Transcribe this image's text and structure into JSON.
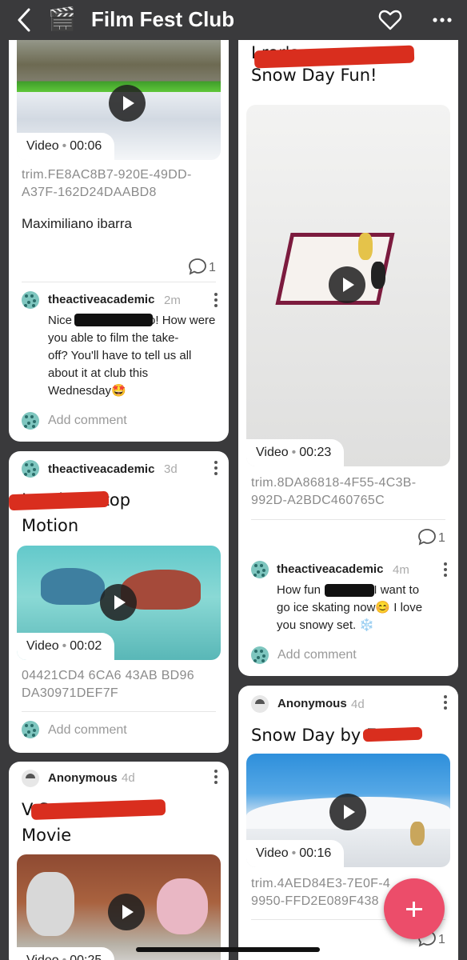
{
  "header": {
    "title": "Film Fest Club",
    "app_icon": "🎬"
  },
  "cards": {
    "c1": {
      "video_label": "Video",
      "duration": "00:06",
      "filename_line1": "trim.FE8AC8B7-920E-49DD-",
      "filename_line2": "A37F-162D24DAABD8",
      "author_text": "Maximiliano ibarra",
      "comment_count": "1",
      "comment": {
        "user": "theactiveacademic",
        "time": "2m",
        "l1a": "Nice",
        "l1b": "o! How were",
        "l2": "you able to film the take-",
        "l3": "off? You'll have to tell us all",
        "l4": "about it at club this",
        "l5": "Wednesday🤩"
      },
      "add_comment": "Add comment"
    },
    "c2": {
      "user": "theactiveacademic",
      "time": "3d",
      "title_line1": "Jam        le's Stop",
      "title_line2": "Motion",
      "video_label": "Video",
      "duration": "00:02",
      "filename_line1": "04421CD4 6CA6 43AB BD96",
      "filename_line2": "DA30971DEF7F",
      "add_comment": "Add comment"
    },
    "c3": {
      "user": "Anonymous",
      "time": "4d",
      "title_line1": "V                    Snow",
      "title_line2": "Movie",
      "video_label": "Video",
      "duration": "00:25"
    },
    "c4": {
      "title_line0": "I                 rer's",
      "title_line1": "Snow Day Fun!",
      "video_label": "Video",
      "duration": "00:23",
      "filename_line1": "trim.8DA86818-4F55-4C3B-",
      "filename_line2": "992D-A2BDC460765C",
      "comment_count": "1",
      "comment": {
        "user": "theactiveacademic",
        "time": "4m",
        "l1a": "How fun",
        "l1b": "! I want to",
        "l2": "go ice skating now😊 I love",
        "l3": "you snowy set. ❄️"
      },
      "add_comment": "Add comment"
    },
    "c5": {
      "user": "Anonymous",
      "time": "4d",
      "title": "Snow Day by E",
      "video_label": "Video",
      "duration": "00:16",
      "filename_line1": "trim.4AED84E3-7E0F-4",
      "filename_line2": "9950-FFD2E089F438",
      "comment_count": "1"
    }
  },
  "colors": {
    "background": "#3a3a3c",
    "card": "#ffffff",
    "fab": "#ec4d6a",
    "redaction": "#d92e1e",
    "avatar": "#7ec6bf"
  }
}
